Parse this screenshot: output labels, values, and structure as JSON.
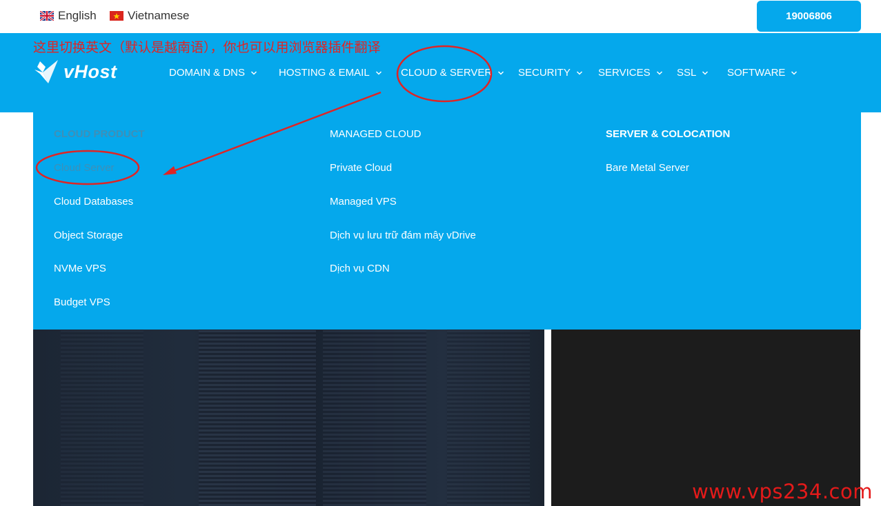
{
  "languages": [
    {
      "label": "English"
    },
    {
      "label": "Vietnamese"
    }
  ],
  "hotline": "19006806",
  "annotation_note": "这里切换英文（默认是越南语），你也可以用浏览器插件翻译",
  "logo": {
    "text": "vHost"
  },
  "nav": [
    {
      "label": "DOMAIN & DNS"
    },
    {
      "label": "HOSTING & EMAIL"
    },
    {
      "label": "CLOUD & SERVER"
    },
    {
      "label": "SECURITY"
    },
    {
      "label": "SERVICES"
    },
    {
      "label": "SSL"
    },
    {
      "label": "SOFTWARE"
    }
  ],
  "dropdown": {
    "col1": {
      "heading": "CLOUD PRODUCT",
      "items": [
        "Cloud Server",
        "Cloud Databases",
        "Object Storage",
        "NVMe VPS",
        "Budget VPS"
      ]
    },
    "col2": {
      "items": [
        "MANAGED CLOUD",
        "Private Cloud",
        "Managed VPS",
        "Dịch vụ lưu trữ đám mây vDrive",
        "Dịch vụ CDN"
      ]
    },
    "col3": {
      "heading": "SERVER & COLOCATION",
      "items": [
        "Bare Metal Server"
      ]
    }
  },
  "watermark": "www.vps234.com",
  "colors": {
    "brand": "#05a8ec",
    "annotation": "#e02424"
  }
}
